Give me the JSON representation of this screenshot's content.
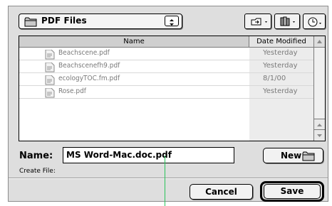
{
  "dialog": {
    "folder_popup": {
      "label": "PDF Files",
      "icon": "folder-icon"
    },
    "toolbar": {
      "desktop_icon": "desktop-icon",
      "shortcuts_icon": "shortcuts-icon",
      "recent_icon": "clock-icon"
    },
    "file_list": {
      "columns": {
        "name": "Name",
        "date": "Date Modified"
      },
      "files": [
        {
          "name": "Beachscene.pdf",
          "date": "Yesterday",
          "icon": "pdf-document-icon"
        },
        {
          "name": "Beachscenefh9.pdf",
          "date": "Yesterday",
          "icon": "pdf-document-icon"
        },
        {
          "name": "ecologyTOC.fm.pdf",
          "date": "8/1/00",
          "icon": "pdf-document-icon"
        },
        {
          "name": "Rose.pdf",
          "date": "Yesterday",
          "icon": "pdf-document-icon"
        }
      ]
    },
    "name_label": "Name:",
    "name_value": "MS Word-Mac.doc.pdf",
    "new_button": "New",
    "create_file_label": "Create File:",
    "cancel_button": "Cancel",
    "save_button": "Save"
  }
}
